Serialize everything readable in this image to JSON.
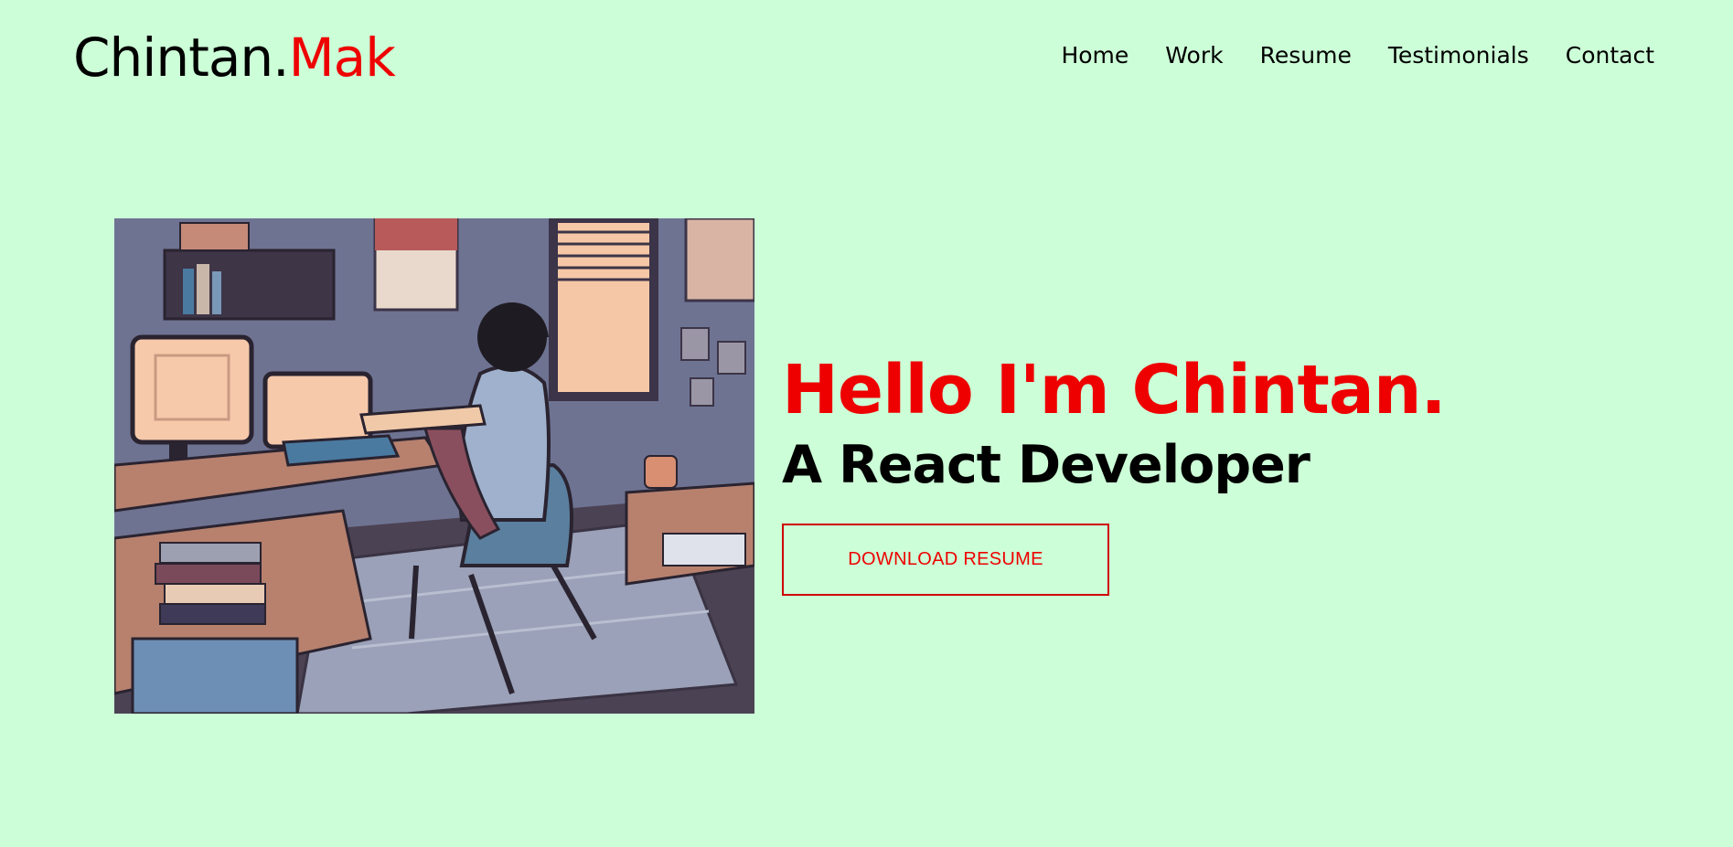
{
  "brand": {
    "name_primary": "Chintan.",
    "name_accent": "Mak",
    "accent_color": "#ee0000"
  },
  "nav": {
    "items": [
      {
        "label": "Home"
      },
      {
        "label": "Work"
      },
      {
        "label": "Resume"
      },
      {
        "label": "Testimonials"
      },
      {
        "label": "Contact"
      }
    ]
  },
  "hero": {
    "greeting": "Hello I'm Chintan.",
    "role": "A React Developer",
    "download_label": "DOWNLOAD RESUME",
    "image_alt": "illustration of developer at desk"
  },
  "colors": {
    "background": "#ccffd7",
    "accent": "#ee0000",
    "text": "#000000"
  }
}
